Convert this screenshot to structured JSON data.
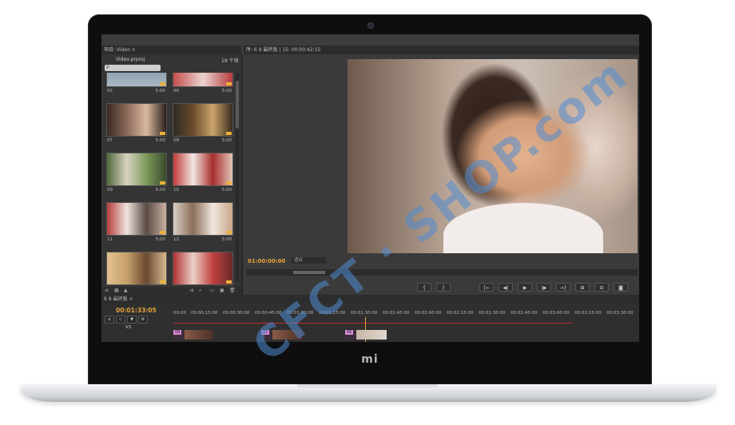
{
  "brand": "mi",
  "project": {
    "tab": "项目: Video ×",
    "file": "Video.prproj",
    "count": "19 个项",
    "search_placeholder": "ρ",
    "clips": [
      {
        "num": "05",
        "dur": "5:00"
      },
      {
        "num": "06",
        "dur": "5:00"
      },
      {
        "num": "07",
        "dur": "5:00"
      },
      {
        "num": "08",
        "dur": "5:00"
      },
      {
        "num": "09",
        "dur": "5:00"
      },
      {
        "num": "10",
        "dur": "5:00"
      },
      {
        "num": "11",
        "dur": "5:00"
      },
      {
        "num": "12",
        "dur": "5:00"
      },
      {
        "num": "",
        "dur": ""
      },
      {
        "num": "",
        "dur": ""
      }
    ]
  },
  "monitor": {
    "tab": "序: 6 9 最终版 | 15: 00:00:42:15",
    "timecode": "01:00:00:00",
    "fit": "适合"
  },
  "transport": [
    "{",
    "}",
    "{←",
    "◀|",
    "▶",
    "|▶",
    "→}",
    "⊞",
    "⊟",
    "◙"
  ],
  "timeline": {
    "tab": "6 9 最终版 ×",
    "timecode": "00:01:33:05",
    "ruler": [
      "00:00",
      "00:00:15:00",
      "00:00:30:00",
      "00:00:45:00",
      "00:01:00:00",
      "00:01:15:00",
      "00:01:30:00",
      "00:01:45:00",
      "00:02:00:00",
      "00:02:15:00",
      "00:02:30:00",
      "00:02:45:00",
      "00:03:00:00",
      "00:03:15:00",
      "00:03:30:00"
    ],
    "track_label": "V3",
    "clips": [
      "08",
      "15",
      "06"
    ]
  },
  "watermark": "CFCT · SHOP.com"
}
